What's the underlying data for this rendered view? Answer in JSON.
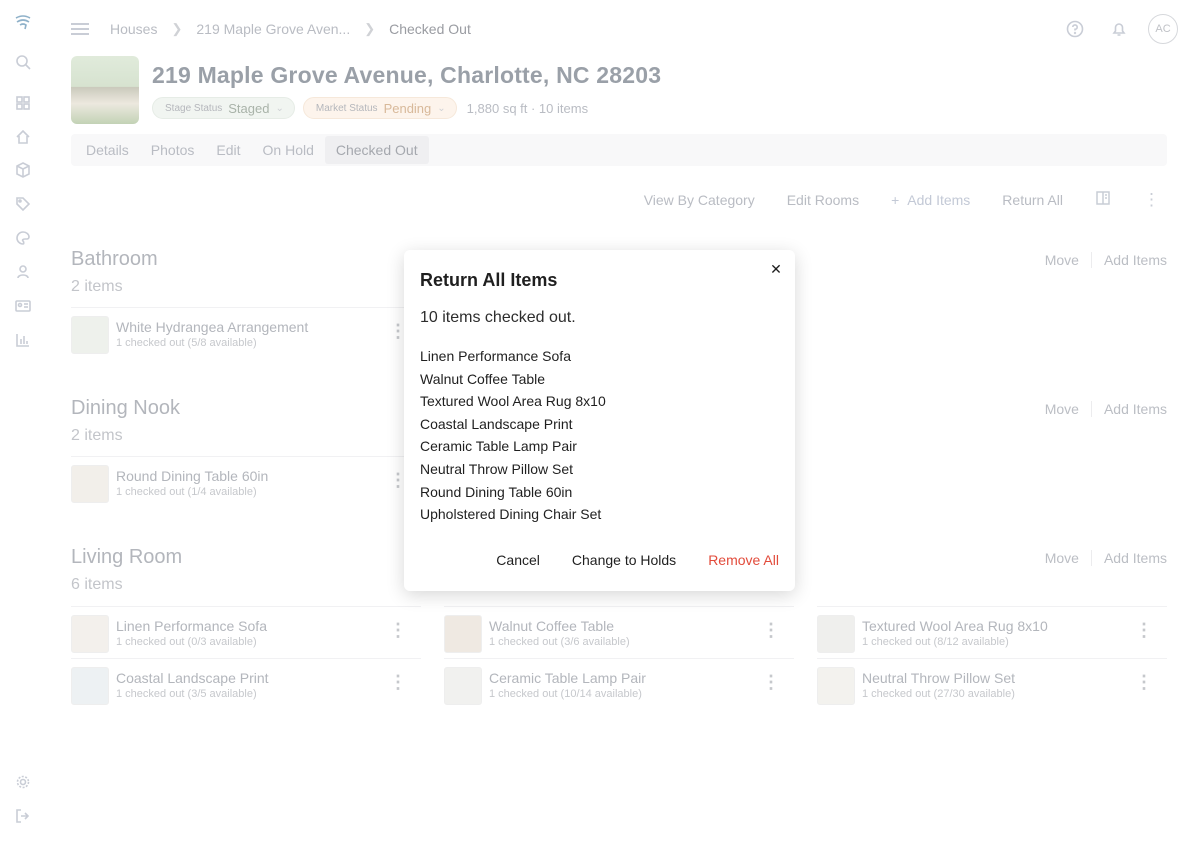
{
  "rail": {
    "icons": [
      "logo-icon",
      "search-icon",
      "dashboard-icon",
      "home-icon",
      "box-icon",
      "tag-icon",
      "palette-icon",
      "user-icon",
      "id-card-icon",
      "chart-icon",
      "settings-icon",
      "logout-icon"
    ]
  },
  "topbar": {
    "breadcrumbs": [
      "Houses",
      "219 Maple Grove Aven...",
      "Checked Out"
    ],
    "avatar_initials": "AC"
  },
  "house": {
    "title": "219 Maple Grove Avenue, Charlotte, NC 28203",
    "stage_label": "Stage Status",
    "stage_value": "Staged",
    "market_label": "Market Status",
    "market_value": "Pending",
    "meta": "1,880 sq ft · 10 items"
  },
  "tabs": [
    "Details",
    "Photos",
    "Edit",
    "On Hold",
    "Checked Out"
  ],
  "actions": {
    "view_by_category": "View By Category",
    "edit_rooms": "Edit Rooms",
    "add_items": "Add Items",
    "return_all": "Return All"
  },
  "sections": [
    {
      "title": "Bathroom",
      "count": "2 items",
      "move": "Move",
      "add": "Add Items",
      "items": [
        {
          "name": "White Hydrangea Arrangement",
          "sub": "1 checked out (5/8 available)"
        }
      ]
    },
    {
      "title": "Dining Nook",
      "count": "2 items",
      "move": "Move",
      "add": "Add Items",
      "items": [
        {
          "name": "Round Dining Table 60in",
          "sub": "1 checked out (1/4 available)"
        }
      ]
    },
    {
      "title": "Living Room",
      "count": "6 items",
      "move": "Move",
      "add": "Add Items",
      "items": [
        {
          "name": "Linen Performance Sofa",
          "sub": "1 checked out (0/3 available)"
        },
        {
          "name": "Walnut Coffee Table",
          "sub": "1 checked out (3/6 available)"
        },
        {
          "name": "Textured Wool Area Rug 8x10",
          "sub": "1 checked out (8/12 available)"
        },
        {
          "name": "Coastal Landscape Print",
          "sub": "1 checked out (3/5 available)"
        },
        {
          "name": "Ceramic Table Lamp Pair",
          "sub": "1 checked out (10/14 available)"
        },
        {
          "name": "Neutral Throw Pillow Set",
          "sub": "1 checked out (27/30 available)"
        }
      ]
    }
  ],
  "modal": {
    "title": "Return All Items",
    "message": "10 items checked out.",
    "items": [
      "Linen Performance Sofa",
      "Walnut Coffee Table",
      "Textured Wool Area Rug 8x10",
      "Coastal Landscape Print",
      "Ceramic Table Lamp Pair",
      "Neutral Throw Pillow Set",
      "Round Dining Table 60in",
      "Upholstered Dining Chair Set"
    ],
    "cancel": "Cancel",
    "change_to_holds": "Change to Holds",
    "remove_all": "Remove All"
  }
}
